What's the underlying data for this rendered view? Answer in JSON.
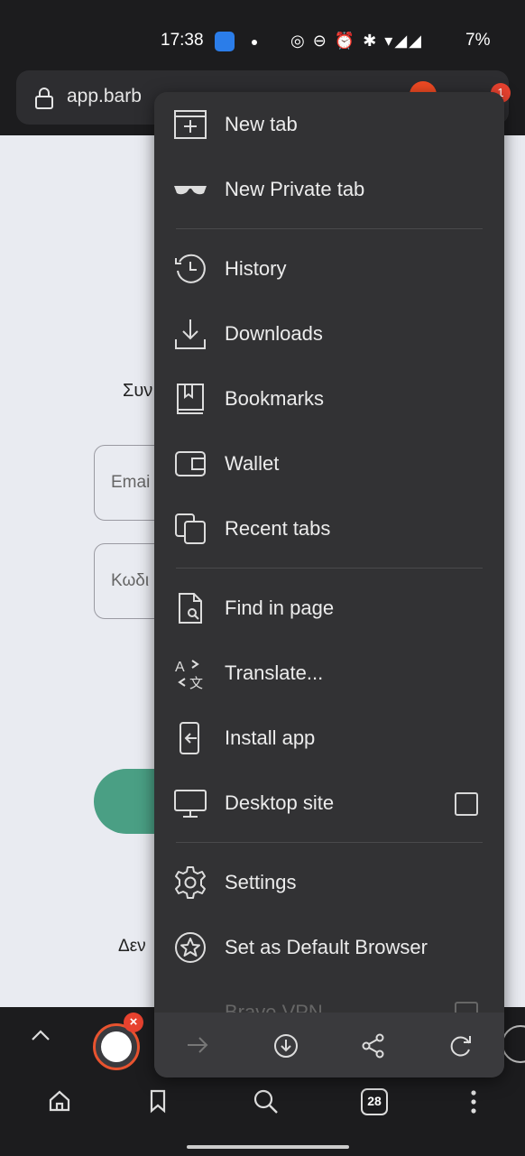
{
  "status_bar": {
    "time": "17:38",
    "battery": "7%",
    "icons": [
      "notification-icon",
      "dot",
      "hotspot-icon",
      "dnd-icon",
      "alarm-icon",
      "bluetooth-icon",
      "wifi-icon",
      "signal-icon",
      "signal-icon"
    ]
  },
  "address_bar": {
    "url": "app.barb",
    "notification_count": "1"
  },
  "page": {
    "heading_fragment": "Συν",
    "email_placeholder": "Emai",
    "password_placeholder": "Κωδι",
    "footer_fragment": "Δεν",
    "accent_color": "#4a9f84"
  },
  "menu": {
    "items": [
      {
        "label": "New tab",
        "icon": "new-tab-icon"
      },
      {
        "label": "New Private tab",
        "icon": "private-glasses-icon"
      },
      {
        "label": "History",
        "icon": "history-icon"
      },
      {
        "label": "Downloads",
        "icon": "download-icon"
      },
      {
        "label": "Bookmarks",
        "icon": "bookmarks-icon"
      },
      {
        "label": "Wallet",
        "icon": "wallet-icon"
      },
      {
        "label": "Recent tabs",
        "icon": "recent-tabs-icon"
      },
      {
        "label": "Find in page",
        "icon": "find-in-page-icon"
      },
      {
        "label": "Translate...",
        "icon": "translate-icon"
      },
      {
        "label": "Install app",
        "icon": "install-app-icon"
      },
      {
        "label": "Desktop site",
        "icon": "desktop-icon",
        "checked": false
      },
      {
        "label": "Settings",
        "icon": "settings-icon"
      },
      {
        "label": "Set as Default Browser",
        "icon": "star-badge-icon"
      },
      {
        "label": "Brave VPN",
        "icon": "vpn-icon",
        "checked": false
      }
    ],
    "bottom_actions": [
      "forward-icon",
      "download-page-icon",
      "share-icon",
      "reload-icon"
    ]
  },
  "bottom_nav": {
    "tab_count": "28",
    "items": [
      "home-icon",
      "bookmark-icon",
      "search-icon",
      "tabs-icon",
      "more-icon"
    ]
  }
}
